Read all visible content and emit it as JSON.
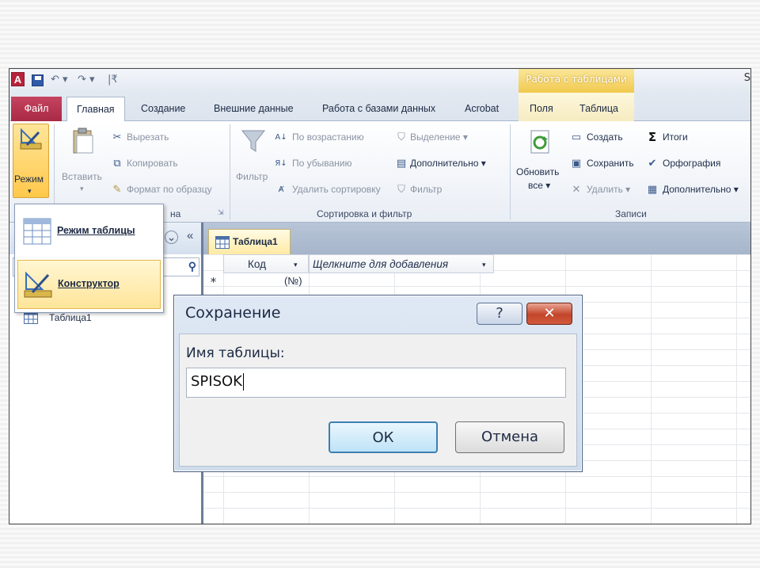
{
  "qat": {
    "app_letter": "A",
    "undo": "↶ ▾",
    "redo": "↷ ▾",
    "customize": "|₹",
    "context_title": "Работа с таблицами",
    "window_title_fragment": "S"
  },
  "tabs": [
    {
      "label": "Файл"
    },
    {
      "label": "Главная"
    },
    {
      "label": "Создание"
    },
    {
      "label": "Внешние данные"
    },
    {
      "label": "Работа с базами данных"
    },
    {
      "label": "Acrobat"
    },
    {
      "label": "Поля"
    },
    {
      "label": "Таблица"
    }
  ],
  "ribbon": {
    "views": {
      "mode_label": "Режим",
      "mode_arrow": "▾"
    },
    "clipboard": {
      "paste_label": "Вставить",
      "paste_arrow": "▾",
      "cut": "Вырезать",
      "copy": "Копировать",
      "format_painter": "Формат по образцу",
      "group_label_fragment": "на",
      "launcher": "⇲"
    },
    "sort_filter": {
      "filter_label": "Фильтр",
      "ascending": "По возрастанию",
      "descending": "По убыванию",
      "remove_sort": "Удалить сортировку",
      "selection": "Выделение ▾",
      "advanced": "Дополнительно ▾",
      "toggle_filter": "Фильтр",
      "group_label": "Сортировка и фильтр"
    },
    "records": {
      "refresh_line1": "Обновить",
      "refresh_line2": "все ▾",
      "new": "Создать",
      "save": "Сохранить",
      "delete": "Удалить ▾",
      "totals": "Итоги",
      "spelling": "Орфография",
      "more": "Дополнительно ▾",
      "group_label": "Записи"
    }
  },
  "menu": {
    "items": [
      {
        "label": "Режим таблицы"
      },
      {
        "label": "Конструктор"
      }
    ]
  },
  "nav": {
    "collapse_glyph": "«",
    "dropdown_glyph": "⌄",
    "items": [
      {
        "label": "Таблица1"
      }
    ]
  },
  "doc": {
    "tab_label": "Таблица1",
    "columns": [
      {
        "label": "Код",
        "arrow": "▾"
      },
      {
        "label": "Щелкните для добавления",
        "arrow": "▾"
      }
    ],
    "new_row_marker": "*",
    "new_row_value": "(№)"
  },
  "dialog": {
    "title": "Сохранение",
    "help": "?",
    "close": "✕",
    "field_label": "Имя таблицы:",
    "field_value": "SPISOK",
    "ok": "ОК",
    "cancel": "Отмена"
  }
}
